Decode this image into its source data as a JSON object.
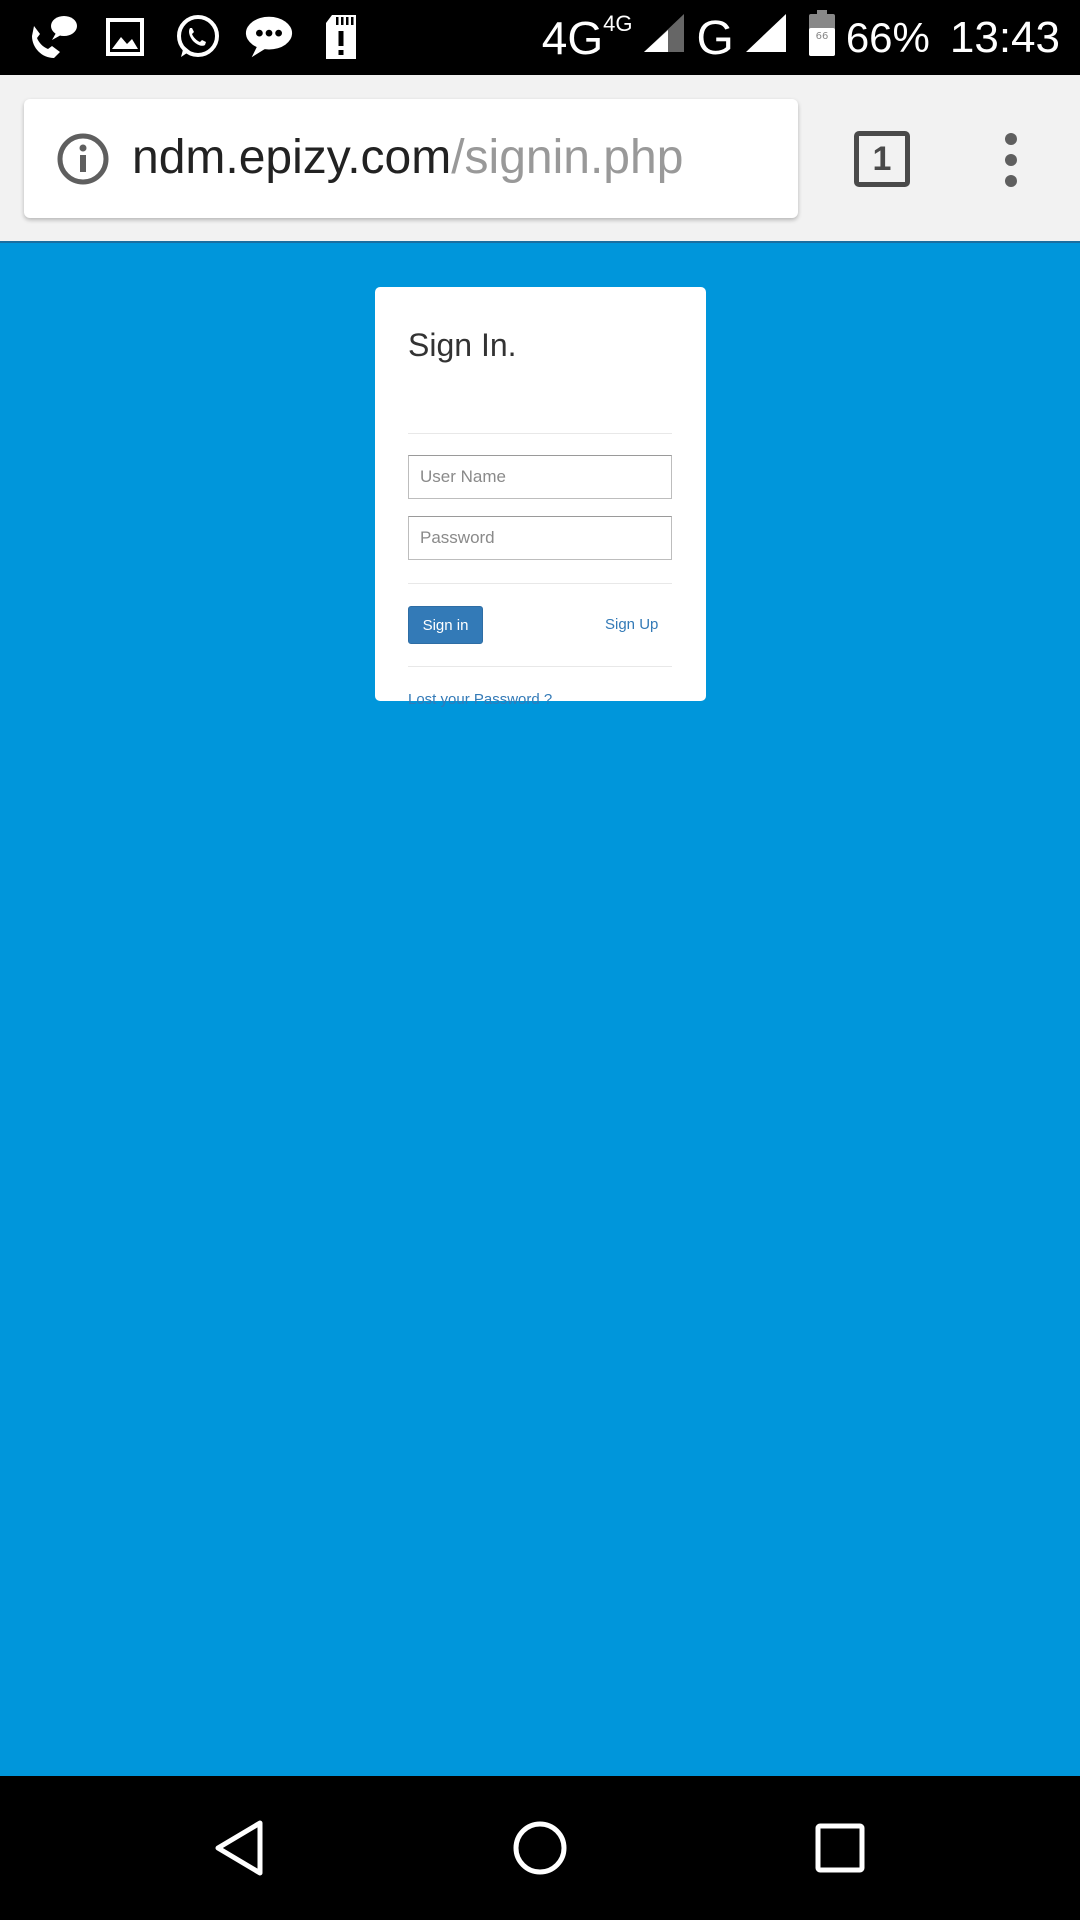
{
  "status_bar": {
    "notification_icons": [
      "missed-call-icon",
      "image-icon",
      "whatsapp-icon",
      "sms-icon",
      "sd-card-alert-icon"
    ],
    "network_primary": "4G",
    "network_primary_sub": "4G",
    "network_secondary": "G",
    "battery_icon_level": "66",
    "battery_percent": "66%",
    "time": "13:43"
  },
  "browser": {
    "url_host": "ndm.epizy.com",
    "url_path": "/signin.php",
    "tab_count": "1",
    "icons": {
      "site_info": "info-icon",
      "menu": "more-vert-icon"
    }
  },
  "signin_card": {
    "title": "Sign In.",
    "username_placeholder": "User Name",
    "password_placeholder": "Password",
    "signin_button": "Sign in",
    "signup_link": "Sign Up",
    "lost_password_link": "Lost your Password ?"
  },
  "colors": {
    "page_background": "#0096db",
    "primary_button": "#337ab7",
    "link": "#337ab7"
  },
  "nav_bar": {
    "icons": [
      "back-icon",
      "home-icon",
      "recents-icon"
    ]
  }
}
